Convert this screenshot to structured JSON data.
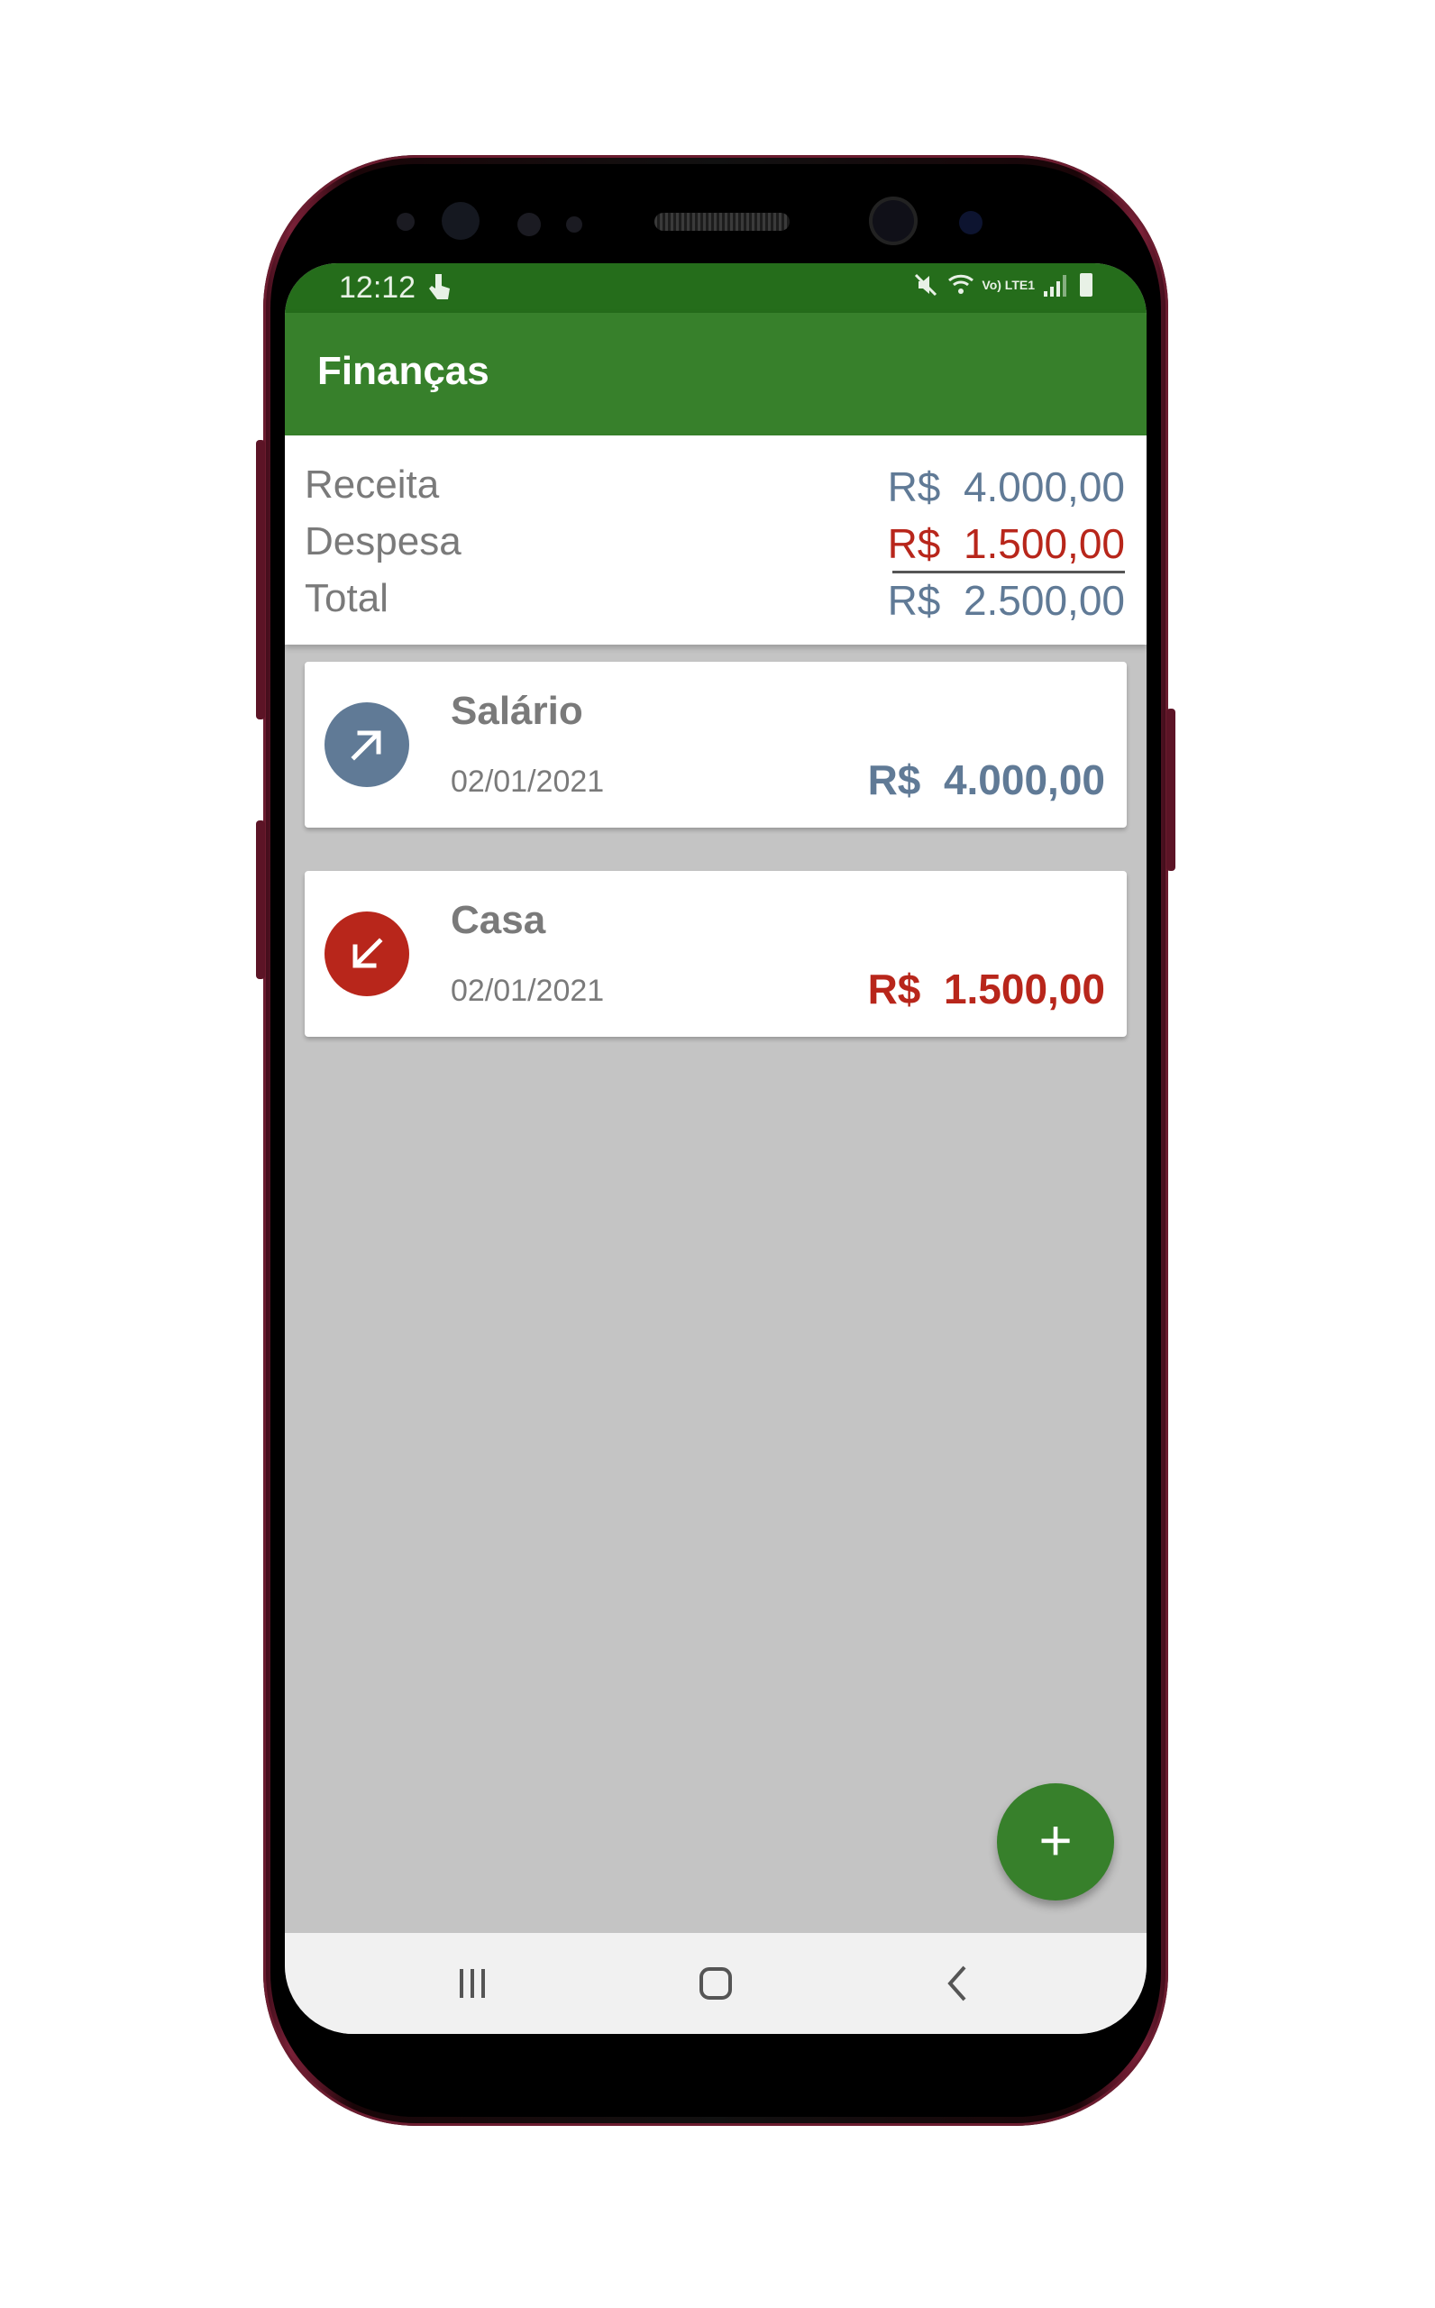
{
  "status_bar": {
    "time": "12:12",
    "lte_label": "Vo) LTE1",
    "icons": [
      "touch-icon",
      "mute-icon",
      "wifi-icon",
      "signal-icon",
      "battery-icon"
    ]
  },
  "app_bar": {
    "title": "Finanças"
  },
  "summary": {
    "income_label": "Receita",
    "income_value": "R$  4.000,00",
    "expense_label": "Despesa",
    "expense_value": "R$  1.500,00",
    "total_label": "Total",
    "total_value": "R$  2.500,00"
  },
  "transactions": [
    {
      "title": "Salário",
      "date": "02/01/2021",
      "value": "R$  4.000,00",
      "type": "income",
      "icon": "arrow-up-right-icon",
      "color": "#607a96"
    },
    {
      "title": "Casa",
      "date": "02/01/2021",
      "value": "R$  1.500,00",
      "type": "expense",
      "icon": "arrow-down-left-icon",
      "color": "#b8261b"
    }
  ],
  "fab": {
    "label": "+"
  },
  "nav_bar": {
    "buttons": [
      "recents-icon",
      "home-icon",
      "back-icon"
    ]
  },
  "colors": {
    "primary": "#37802b",
    "primary_dark": "#256d1b",
    "income": "#607a96",
    "expense": "#b8261b",
    "background": "#c4c4c4"
  }
}
